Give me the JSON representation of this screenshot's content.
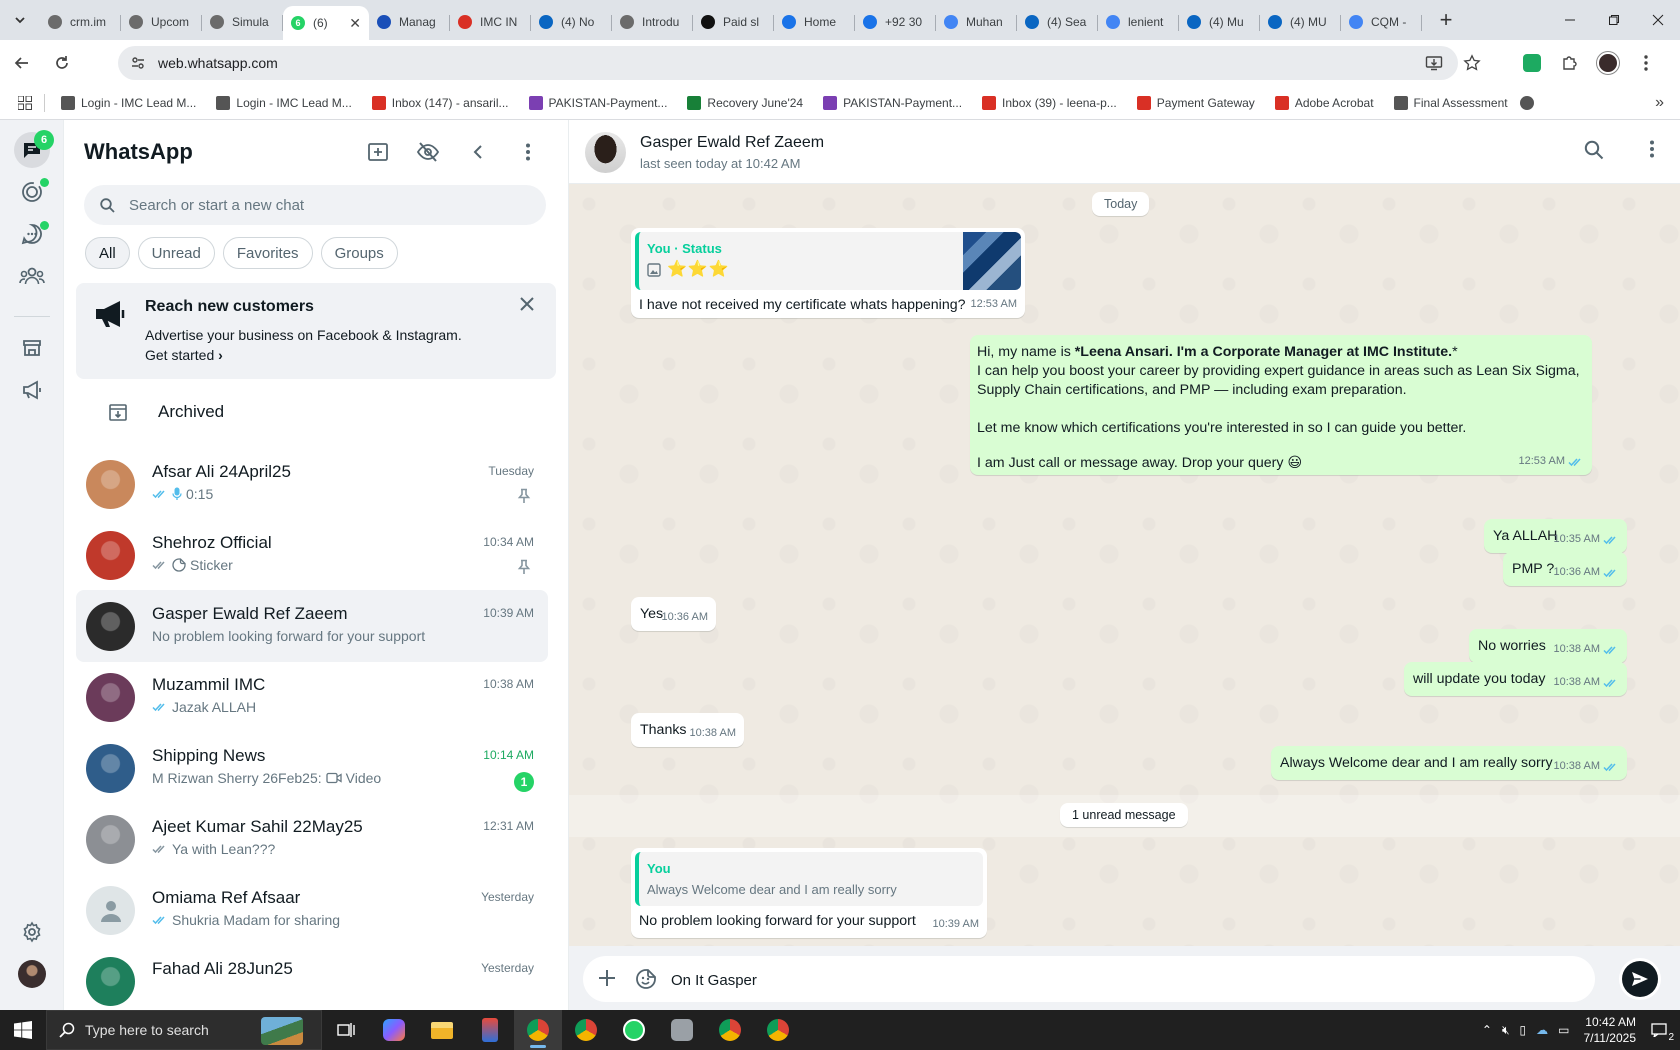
{
  "browser": {
    "tabs": [
      {
        "title": "crm.im",
        "color": "#6b6b6b"
      },
      {
        "title": "Upcom",
        "color": "#6b6b6b"
      },
      {
        "title": "Simula",
        "color": "#6b6b6b"
      },
      {
        "title": "(6)",
        "color": "#25d366",
        "active": true,
        "badge": "6"
      },
      {
        "title": "Manag",
        "color": "#1a4fb8"
      },
      {
        "title": "IMC IN",
        "color": "#d93025"
      },
      {
        "title": "(4) No",
        "color": "#0a66c2"
      },
      {
        "title": "Introdu",
        "color": "#6b6b6b"
      },
      {
        "title": "Paid sl",
        "color": "#111111"
      },
      {
        "title": "Home",
        "color": "#1a73e8"
      },
      {
        "title": "+92 30",
        "color": "#1a73e8"
      },
      {
        "title": "Muhan",
        "color": "#4285f4"
      },
      {
        "title": "(4) Sea",
        "color": "#0a66c2"
      },
      {
        "title": "lenient",
        "color": "#4285f4"
      },
      {
        "title": "(4) Mu",
        "color": "#0a66c2"
      },
      {
        "title": "(4) MU",
        "color": "#0a66c2"
      },
      {
        "title": "CQM -",
        "color": "#4285f4"
      }
    ],
    "url": "web.whatsapp.com",
    "bookmarks": [
      {
        "label": "Login - IMC Lead M...",
        "color": "#555"
      },
      {
        "label": "Login - IMC Lead M...",
        "color": "#555"
      },
      {
        "label": "Inbox (147) - ansaril...",
        "color": "#d93025"
      },
      {
        "label": "PAKISTAN-Payment...",
        "color": "#7b3fb2"
      },
      {
        "label": "Recovery June'24",
        "color": "#188038"
      },
      {
        "label": "PAKISTAN-Payment...",
        "color": "#7b3fb2"
      },
      {
        "label": "Inbox (39) - leena-p...",
        "color": "#d93025"
      },
      {
        "label": "Payment Gateway",
        "color": "#d93025"
      },
      {
        "label": "Adobe Acrobat",
        "color": "#d93025"
      },
      {
        "label": "Final Assessment",
        "color": "#555"
      }
    ]
  },
  "rail": {
    "chats_badge": "6"
  },
  "sidebar": {
    "title": "WhatsApp",
    "search_placeholder": "Search or start a new chat",
    "filters": [
      "All",
      "Unread",
      "Favorites",
      "Groups"
    ],
    "promo": {
      "title": "Reach new customers",
      "subtitle": "Advertise your business on Facebook & Instagram.",
      "cta": "Get started"
    },
    "archived_label": "Archived",
    "chats": [
      {
        "name": "Afsar Ali 24April25",
        "time": "Tuesday",
        "preview": "0:15",
        "ticks": "blue",
        "mic": true,
        "pinned": true,
        "avatar": "#c9885c"
      },
      {
        "name": "Shehroz Official",
        "time": "10:34 AM",
        "preview": "Sticker",
        "ticks": "grey",
        "sticker": true,
        "pinned": true,
        "avatar": "#c0392b"
      },
      {
        "name": "Gasper Ewald Ref Zaeem",
        "time": "10:39 AM",
        "preview": "No problem looking forward for your support",
        "selected": true,
        "avatar": "#2b2b2b"
      },
      {
        "name": "Muzammil IMC",
        "time": "10:38 AM",
        "preview": "Jazak ALLAH",
        "ticks": "blue",
        "avatar": "#6b3b5a"
      },
      {
        "name": "Shipping News",
        "time": "10:14 AM",
        "preview": "M Rizwan Sherry 26Feb25:",
        "video": "Video",
        "unread": "1",
        "avatar": "#2f5d8a"
      },
      {
        "name": "Ajeet Kumar Sahil 22May25",
        "time": "12:31 AM",
        "preview": "Ya with Lean???",
        "ticks": "grey",
        "avatar": "#8c8f94"
      },
      {
        "name": "Omiama Ref Afsaar",
        "time": "Yesterday",
        "preview": "Shukria Madam for sharing",
        "ticks": "blue",
        "default_avatar": true,
        "avatar": "#dfe5e7"
      },
      {
        "name": "Fahad Ali 28Jun25",
        "time": "Yesterday",
        "preview": "",
        "avatar": "#1e7f5c"
      }
    ]
  },
  "conversation": {
    "name": "Gasper Ewald Ref Zaeem",
    "status": "last seen today at 10:42 AM",
    "day_label": "Today",
    "status_reply": {
      "author": "You · Status",
      "stars": "⭐⭐⭐",
      "text": "I have not received my certificate whats happening?",
      "time": "12:53 AM"
    },
    "intro": {
      "line1_prefix": "Hi, my name is ",
      "line1_bold": "*Leena Ansari. I'm a Corporate Manager at IMC Institute.",
      "line1_suffix": "*",
      "line2": "I can help you boost your career by providing expert guidance in areas such as Lean Six Sigma,",
      "line3": "Supply Chain certifications, and PMP — including exam preparation.",
      "line4": "Let me know which certifications you're interested in so I can guide you better.",
      "line5": "I am Just call or message away. Drop your query 😃",
      "time": "12:53 AM"
    },
    "messages": [
      {
        "text": "Ya ALLAH",
        "time": "10:35 AM"
      },
      {
        "text": "PMP ?",
        "time": "10:36 AM"
      },
      {
        "text": "Yes",
        "time": "10:36 AM"
      },
      {
        "text": "No worries",
        "time": "10:38 AM"
      },
      {
        "text": "will update you today",
        "time": "10:38 AM"
      },
      {
        "text": "Thanks",
        "time": "10:38 AM"
      },
      {
        "text": "Always Welcome dear and I am really sorry",
        "time": "10:38 AM"
      }
    ],
    "unread_label": "1 unread message",
    "last_reply": {
      "quote_author": "You",
      "quote_text": "Always Welcome dear and I am really sorry",
      "text": "No problem looking forward for your support",
      "time": "10:39 AM"
    },
    "composer_value": "On It Gasper"
  },
  "taskbar": {
    "search_placeholder": "Type here to search",
    "time": "10:42 AM",
    "date": "7/11/2025",
    "notifications": "2"
  }
}
